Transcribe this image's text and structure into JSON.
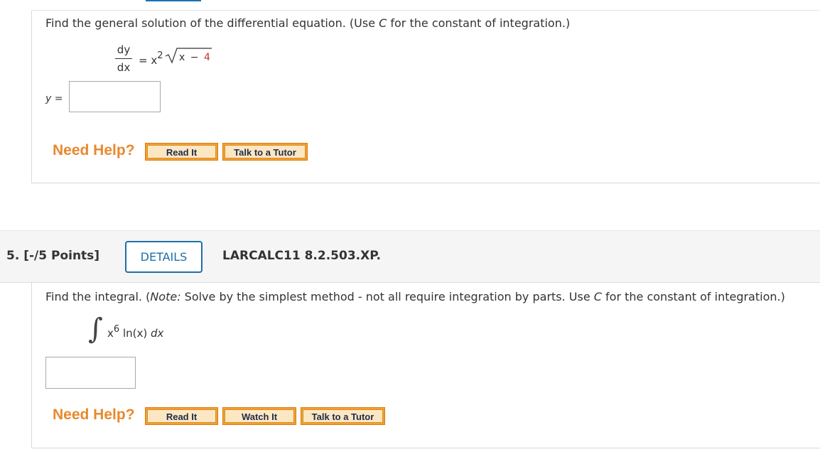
{
  "q4": {
    "prompt_before": "Find the general solution of the differential equation. (Use ",
    "prompt_var": "C",
    "prompt_after": " for the constant of integration.)",
    "equation": {
      "numerator": "dy",
      "denominator": "dx",
      "equals": "=",
      "x": "x",
      "exponent": "2",
      "radicand_var": "x",
      "radicand_op": "−",
      "radicand_const": "4"
    },
    "answer_label": "y =",
    "answer_value": "",
    "need_help": "Need Help?",
    "buttons": [
      "Read It",
      "Talk to a Tutor"
    ]
  },
  "q5": {
    "number": "5.  [-/5 Points]",
    "details_label": "DETAILS",
    "code": "LARCALC11 8.2.503.XP.",
    "prompt_before": "Find the integral. (",
    "prompt_note": "Note:",
    "prompt_middle": " Solve by the simplest method - not all require integration by parts. Use ",
    "prompt_var": "C",
    "prompt_after": " for the constant of integration.)",
    "integral": {
      "sign": "∫",
      "base": "x",
      "exponent": "6",
      "func": " ln(x) ",
      "dx": "dx"
    },
    "answer_value": "",
    "need_help": "Need Help?",
    "buttons": [
      "Read It",
      "Watch It",
      "Talk to a Tutor"
    ]
  },
  "colors": {
    "need_help": "#e8892b",
    "button_outer": "#f0a033",
    "button_inner": "#fce7c3",
    "details_border": "#1f6fa8",
    "radicand_const": "#c0392b"
  }
}
